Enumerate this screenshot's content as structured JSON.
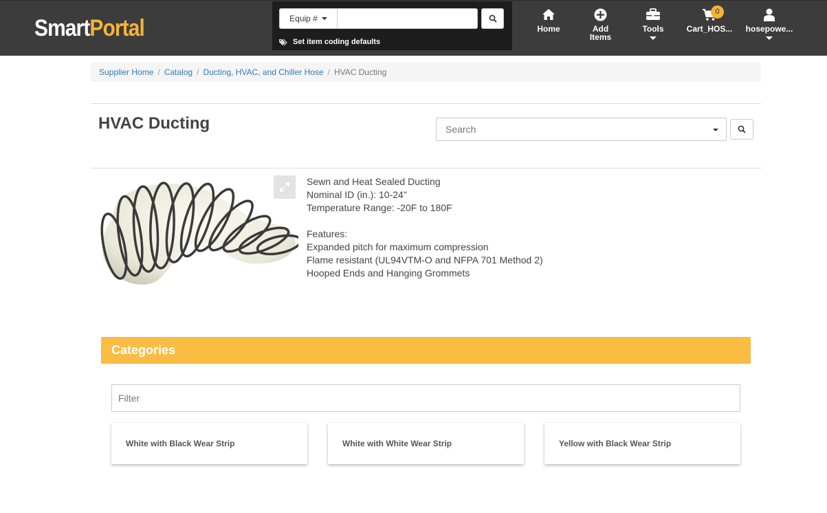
{
  "header": {
    "logo_part1": "Smart",
    "logo_part2": "Portal",
    "equip_label": "Equip #",
    "equip_value": "",
    "coding_defaults": "Set item coding defaults",
    "nav": {
      "home": "Home",
      "add_items_line1": "Add",
      "add_items_line2": "Items",
      "tools": "Tools",
      "cart": "Cart_HOS...",
      "cart_count": "0",
      "user": "hosepowe..."
    }
  },
  "breadcrumb": {
    "items": [
      "Supplier Home",
      "Catalog",
      "Ducting, HVAC, and Chiller Hose"
    ],
    "current": "HVAC Ducting",
    "separator": "/"
  },
  "page": {
    "title": "HVAC Ducting",
    "search_placeholder": "Search"
  },
  "product": {
    "lines": [
      "Sewn and Heat Sealed Ducting",
      "Nominal ID (in.): 10-24\"",
      "Temperature Range: -20F to 180F"
    ],
    "features_title": "Features:",
    "features": [
      "Expanded pitch for maximum compression",
      "Flame resistant (UL94VTM-O and NFPA 701 Method 2)",
      "Hooped Ends and Hanging Grommets"
    ]
  },
  "categories": {
    "title": "Categories",
    "filter_placeholder": "Filter",
    "items": [
      "White with Black Wear Strip",
      "White with White Wear Strip",
      "Yellow with Black Wear Strip"
    ]
  },
  "colors": {
    "navbar": "#3c3c3c",
    "search_panel": "#1d1d1d",
    "accent": "#fbbc43",
    "link": "#337ab7"
  }
}
